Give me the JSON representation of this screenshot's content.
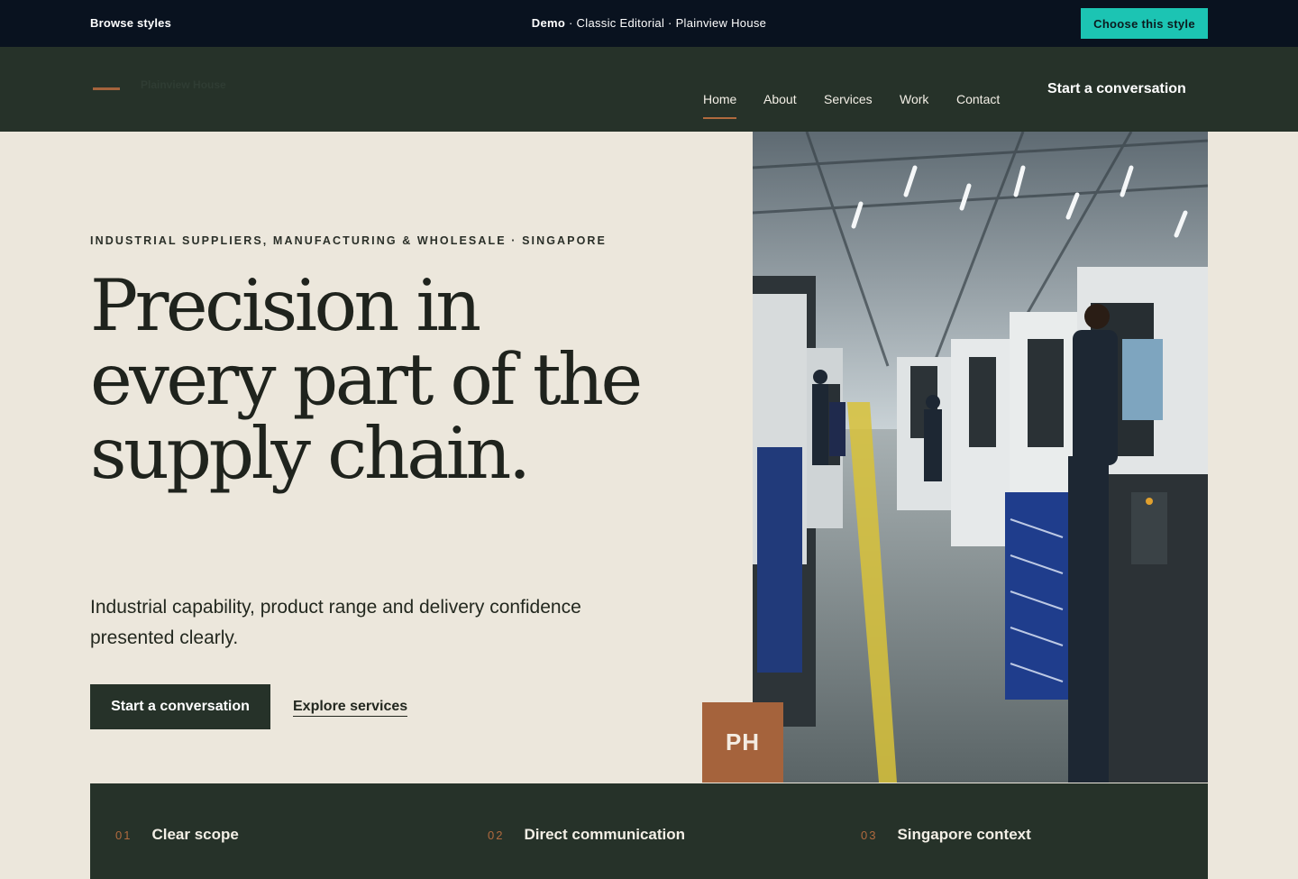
{
  "demo_bar": {
    "browse_label": "Browse styles",
    "demo_prefix": "Demo",
    "demo_suffix": " · Classic Editorial · Plainview House",
    "choose_label": "Choose this style"
  },
  "header": {
    "logo_text": "Plainview House",
    "nav": [
      {
        "label": "Home",
        "active": true
      },
      {
        "label": "About"
      },
      {
        "label": "Services"
      },
      {
        "label": "Work"
      },
      {
        "label": "Contact"
      }
    ],
    "cta_label": "Start a conversation"
  },
  "hero": {
    "eyebrow": "INDUSTRIAL SUPPLIERS, MANUFACTURING & WHOLESALE · SINGAPORE",
    "headline": "Precision in every part of the supply chain.",
    "subcopy": "Industrial capability, product range and delivery confidence presented clearly.",
    "primary_cta": "Start a conversation",
    "secondary_cta": "Explore services",
    "badge": "PH",
    "image_icon": "factory-floor-photo"
  },
  "features": [
    {
      "num": "01",
      "label": "Clear scope"
    },
    {
      "num": "02",
      "label": "Direct communication"
    },
    {
      "num": "03",
      "label": "Singapore context"
    }
  ],
  "colors": {
    "background": "#ece7dc",
    "dark_green": "#263229",
    "accent_copper": "#a5633c",
    "teal": "#1cc4b3",
    "demo_bar": "#09121f"
  }
}
